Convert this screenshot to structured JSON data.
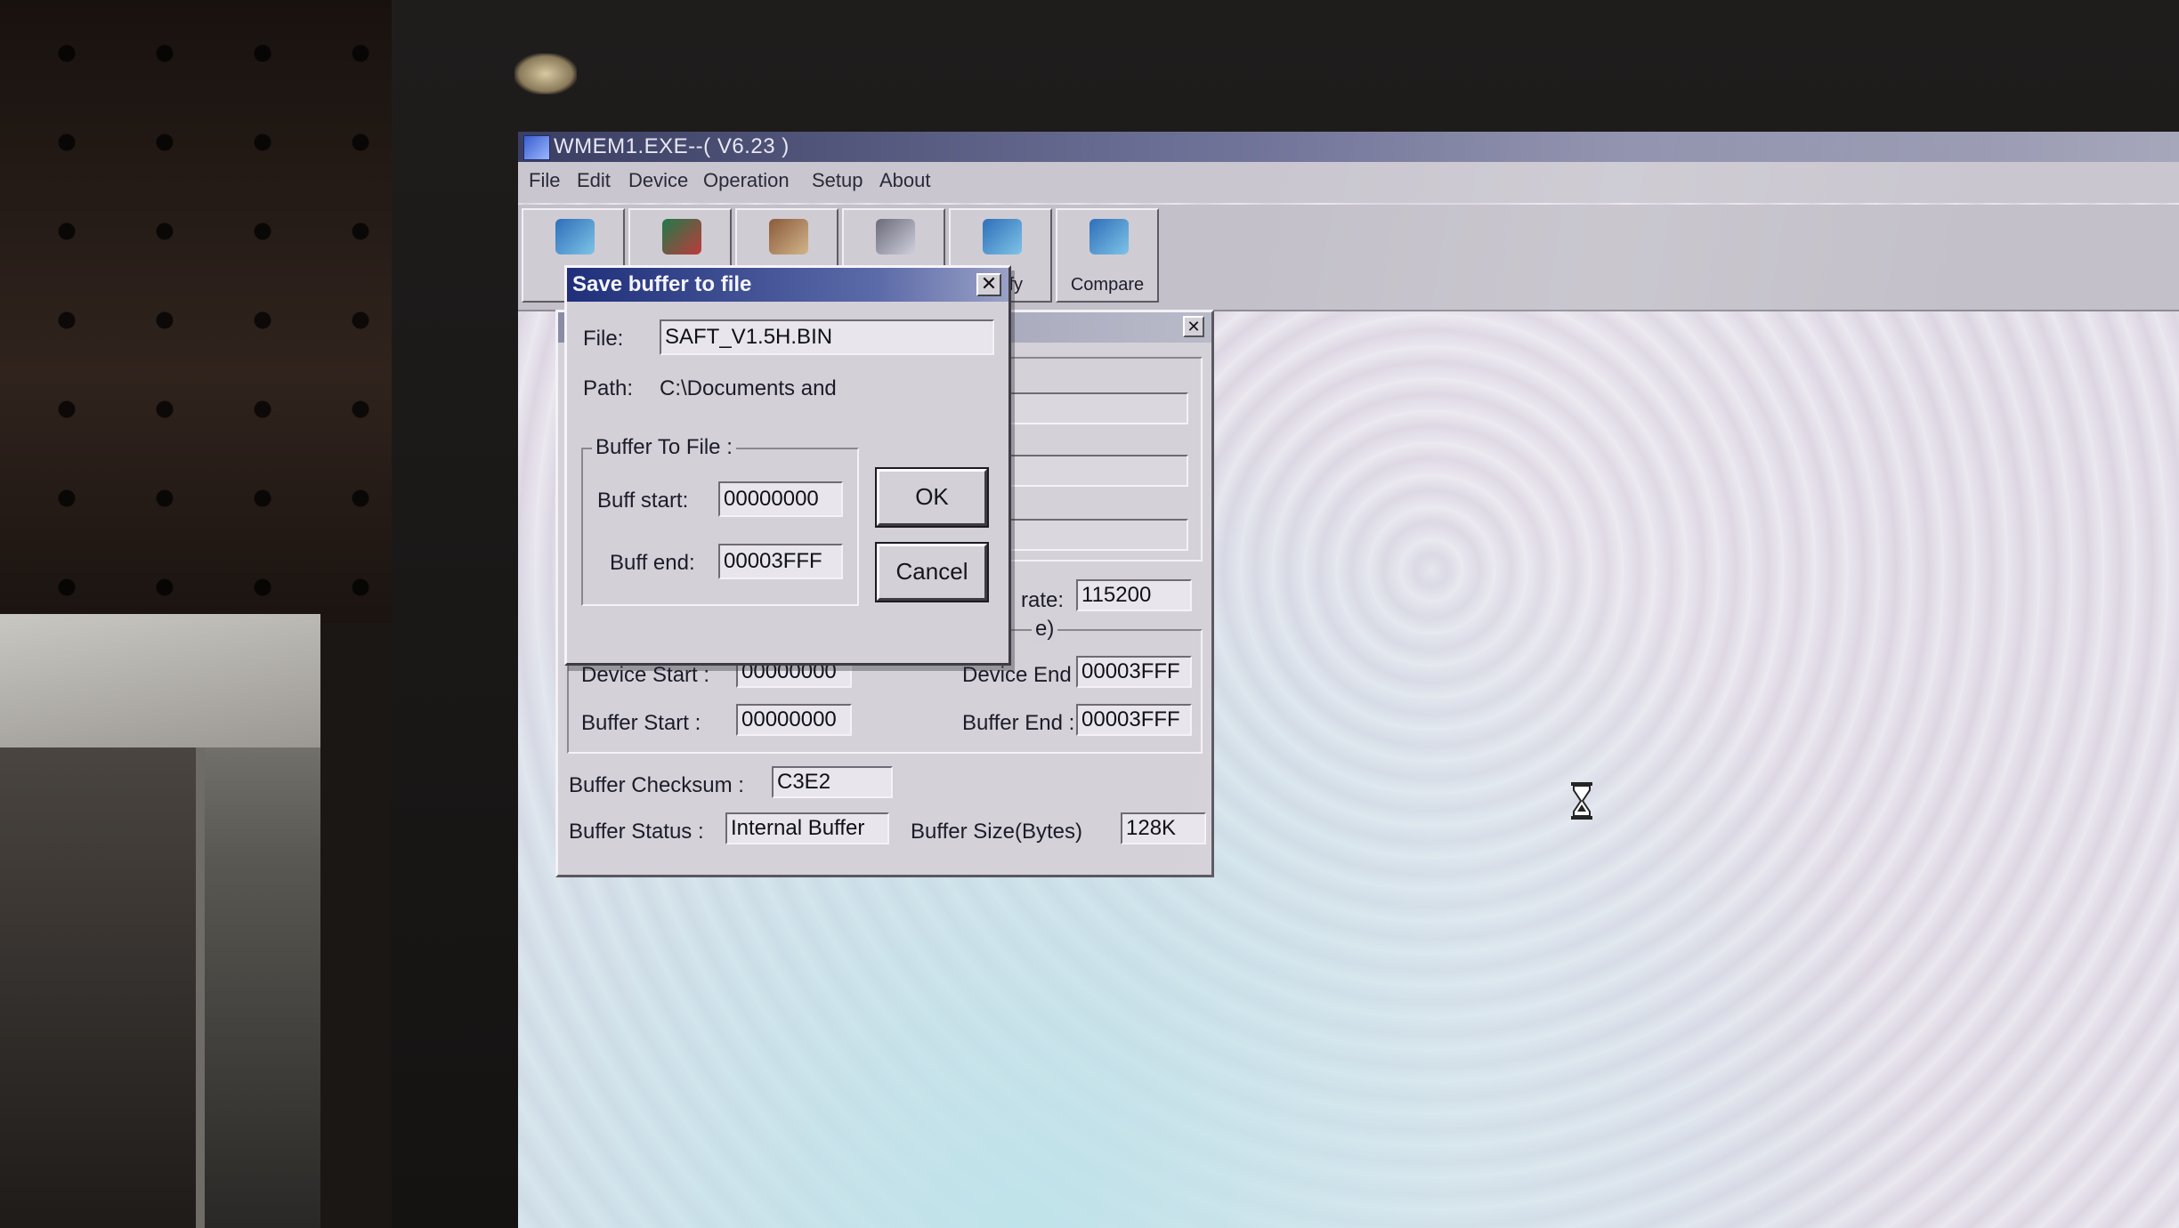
{
  "window": {
    "title": "WMEM1.EXE--( V6.23 )"
  },
  "menu": {
    "items": [
      "File",
      "Edit",
      "Device",
      "Operation",
      "Setup",
      "About"
    ]
  },
  "toolbar": {
    "compare_label": "Compare",
    "verify_label": "Verify"
  },
  "panel": {
    "baud_label": "rate:",
    "baud_value": "115200",
    "device_start_label": "Device Start :",
    "device_start_value": "00000000",
    "device_end_label": "Device End",
    "device_end_value": "00003FFF",
    "buffer_start_label": "Buffer Start :",
    "buffer_start_value": "00000000",
    "buffer_end_label": "Buffer End :",
    "buffer_end_value": "00003FFF",
    "checksum_label": "Buffer Checksum :",
    "checksum_value": "C3E2",
    "status_label": "Buffer Status :",
    "status_value": "Internal Buffer",
    "size_label": "Buffer Size(Bytes)",
    "size_value": "128K",
    "group_tail": "e)"
  },
  "dialog": {
    "title": "Save buffer to file",
    "file_label": "File:",
    "file_value": "SAFT_V1.5H.BIN",
    "path_label": "Path:",
    "path_value": "C:\\Documents and",
    "group_label": "Buffer To File :",
    "buff_start_label": "Buff start:",
    "buff_start_value": "00000000",
    "buff_end_label": "Buff end:",
    "buff_end_value": "00003FFF",
    "ok_label": "OK",
    "cancel_label": "Cancel"
  },
  "colors": {
    "title_active": "#1f2f7a",
    "dialog_face": "#d3d0d8"
  }
}
